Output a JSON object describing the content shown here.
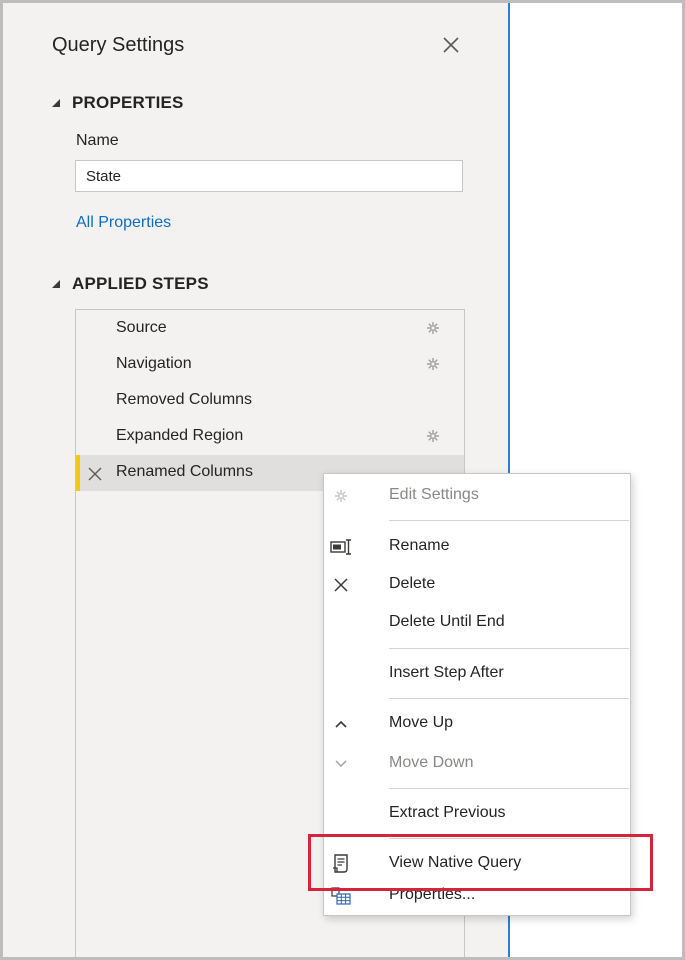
{
  "pane": {
    "title": "Query Settings",
    "close_icon": "close-icon"
  },
  "properties": {
    "header": "PROPERTIES",
    "name_label": "Name",
    "name_value": "State",
    "all_properties_link": "All Properties"
  },
  "applied_steps": {
    "header": "APPLIED STEPS",
    "steps": [
      {
        "label": "Source",
        "has_settings": true,
        "icon": "gear-icon"
      },
      {
        "label": "Navigation",
        "has_settings": true,
        "icon": "gear-icon"
      },
      {
        "label": "Removed Columns",
        "has_settings": false
      },
      {
        "label": "Expanded Region",
        "has_settings": true,
        "icon": "gear-icon"
      },
      {
        "label": "Renamed Columns",
        "selected": true,
        "icon": "delete-x-icon"
      }
    ]
  },
  "context_menu": {
    "items": [
      {
        "label": "Edit Settings",
        "icon": "gear-icon",
        "disabled": true
      },
      {
        "label": "Rename",
        "icon": "rename-icon"
      },
      {
        "label": "Delete",
        "icon": "delete-icon"
      },
      {
        "label": "Delete Until End",
        "icon": ""
      },
      {
        "label": "Insert Step After",
        "icon": ""
      },
      {
        "label": "Move Up",
        "icon": "chevron-up-icon"
      },
      {
        "label": "Move Down",
        "icon": "chevron-down-icon",
        "disabled": true
      },
      {
        "label": "Extract Previous",
        "icon": ""
      },
      {
        "label": "View Native Query",
        "icon": "native-query-icon",
        "highlighted": true
      },
      {
        "label": "Properties...",
        "icon": "properties-icon"
      }
    ]
  },
  "colors": {
    "accent_link": "#0e6ec2",
    "selected_bar": "#f2c811",
    "highlight_box": "#d6243b",
    "pane_border": "#2b7fd6"
  }
}
